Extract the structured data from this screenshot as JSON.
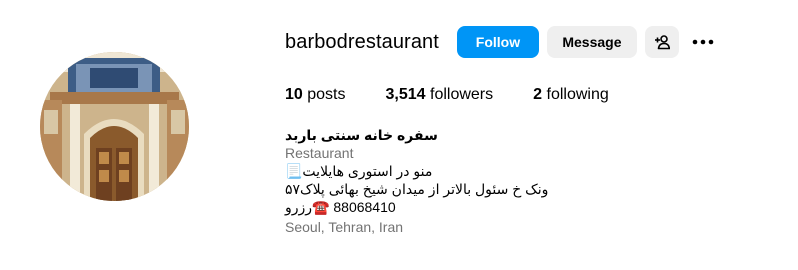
{
  "profile": {
    "username": "barbodrestaurant",
    "follow_label": "Follow",
    "message_label": "Message",
    "add_user_icon": "person-add-icon",
    "more_icon": "more-horizontal-icon"
  },
  "stats": {
    "posts_count": "10",
    "posts_label": "posts",
    "followers_count": "3,514",
    "followers_label": "followers",
    "following_count": "2",
    "following_label": "following"
  },
  "bio": {
    "name": "سفره خانه سنتی باربد",
    "category": "Restaurant",
    "line1": "منو در استوری هایلایت📃",
    "line2": "ونک خ سئول بالاتر از میدان شیخ بهائی پلاک۵۷",
    "line3": "88068410 ☎️رزرو",
    "location": "Seoul, Tehran, Iran"
  },
  "colors": {
    "follow_blue": "#0095f6",
    "button_gray": "#efefef",
    "secondary_text": "#737373"
  }
}
